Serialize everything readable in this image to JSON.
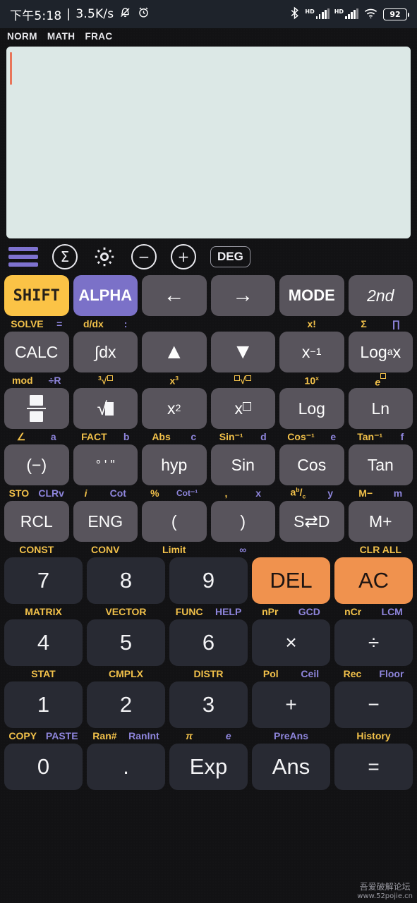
{
  "statusbar": {
    "time": "下午5:18",
    "separator": "|",
    "netspeed": "3.5K/s",
    "mute_icon": "bell-muted-icon",
    "alarm_icon": "alarm-clock-icon",
    "bluetooth_icon": "bluetooth-icon",
    "signal1_label": "HD",
    "signal2_label": "HD",
    "wifi_icon": "wifi-icon",
    "battery_level": "92"
  },
  "modebar": {
    "items": [
      "NORM",
      "MATH",
      "FRAC"
    ]
  },
  "display": {
    "value": "",
    "caret": "text-cursor"
  },
  "toolbar": {
    "menu_icon": "hamburger-menu-icon",
    "sum_icon": "sigma-icon",
    "sum_glyph": "Σ",
    "settings_icon": "gear-icon",
    "zoom_out_glyph": "−",
    "zoom_in_glyph": "+",
    "angle_unit": "DEG"
  },
  "colors": {
    "shift": "#fbc346",
    "alpha": "#7b71c8",
    "orange": "#f0924e",
    "key": "#58545c",
    "numkey": "#282a33",
    "display": "#dce8e6",
    "shift_label": "#f2c14a",
    "alpha_label": "#8e85dc"
  },
  "keypad": {
    "rows": [
      {
        "keys": [
          "SHIFT",
          "ALPHA",
          "←",
          "→",
          "MODE",
          "2nd"
        ],
        "shift_labels": [
          "SOLVE",
          "d/dx",
          "",
          "",
          "x!",
          "Σ"
        ],
        "alpha_labels": [
          "=",
          ":",
          "",
          "",
          "",
          "∏"
        ]
      },
      {
        "keys": [
          "CALC",
          "∫dx",
          "▲",
          "▼",
          "x⁻¹",
          "Log a x"
        ],
        "shift_labels": [
          "mod",
          "³√□",
          "x³",
          "□√□",
          "10ˣ",
          "e□"
        ],
        "alpha_labels": [
          "÷R",
          "",
          "",
          "",
          "",
          ""
        ]
      },
      {
        "keys": [
          "fraction",
          "√□",
          "x²",
          "x□",
          "Log",
          "Ln"
        ],
        "shift_labels": [
          "∠",
          "FACT",
          "Abs",
          "Sin⁻¹",
          "Cos⁻¹",
          "Tan⁻¹"
        ],
        "alpha_labels": [
          "a",
          "b",
          "c",
          "d",
          "e",
          "f"
        ]
      },
      {
        "keys": [
          "(−)",
          "° ' \"",
          "hyp",
          "Sin",
          "Cos",
          "Tan"
        ],
        "shift_labels": [
          "STO",
          "i",
          "%",
          ",",
          "a b/c",
          "M−"
        ],
        "alpha_labels": [
          "CLRv",
          "Cot",
          "Cot⁻¹",
          "x",
          "y",
          "m"
        ]
      },
      {
        "keys": [
          "RCL",
          "ENG",
          "(",
          ")",
          "S⇄D",
          "M+"
        ],
        "shift_labels": [
          "CONST",
          "CONV",
          "Limit",
          "",
          "",
          "CLR ALL"
        ],
        "alpha_labels": [
          "",
          "",
          "",
          "∞",
          "",
          ""
        ]
      }
    ],
    "numrows": [
      {
        "keys": [
          "7",
          "8",
          "9",
          "DEL",
          "AC"
        ],
        "shift_labels": [
          "MATRIX",
          "VECTOR",
          "FUNC",
          "nPr",
          "nCr"
        ],
        "alpha_labels": [
          "",
          "",
          "HELP",
          "GCD",
          "LCM"
        ]
      },
      {
        "keys": [
          "4",
          "5",
          "6",
          "×",
          "÷"
        ],
        "shift_labels": [
          "STAT",
          "CMPLX",
          "DISTR",
          "Pol",
          "Rec"
        ],
        "alpha_labels": [
          "",
          "",
          "",
          "Ceil",
          "Floor"
        ]
      },
      {
        "keys": [
          "1",
          "2",
          "3",
          "+",
          "−"
        ],
        "shift_labels": [
          "COPY",
          "Ran#",
          "π",
          "",
          "History"
        ],
        "alpha_labels": [
          "PASTE",
          "RanInt",
          "e",
          "PreAns",
          ""
        ]
      },
      {
        "keys": [
          "0",
          ".",
          "Exp",
          "Ans",
          "="
        ],
        "shift_labels": [
          "",
          "",
          "",
          "",
          ""
        ],
        "alpha_labels": [
          "",
          "",
          "",
          "",
          ""
        ]
      }
    ]
  },
  "watermark": {
    "line1": "吾爱破解论坛",
    "line2": "www.52pojie.cn"
  }
}
